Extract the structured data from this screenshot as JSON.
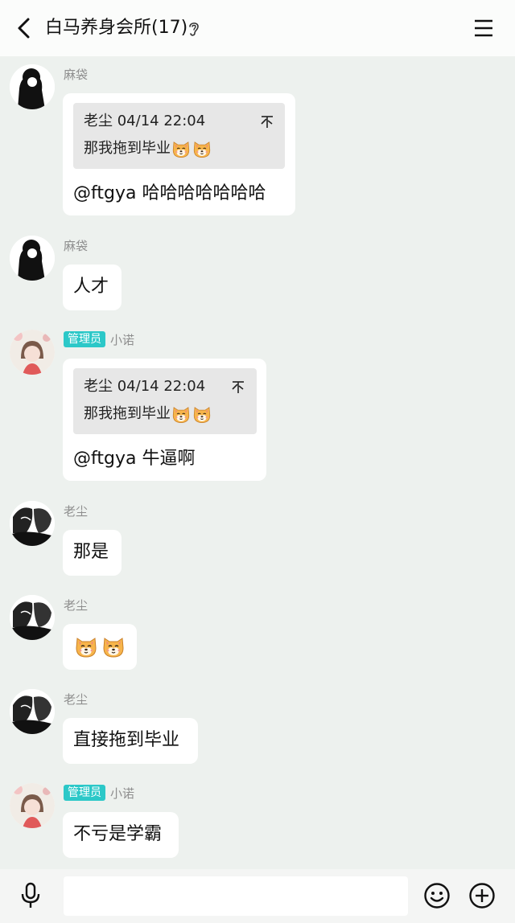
{
  "header": {
    "title": "白马养身会所(17)"
  },
  "messages": [
    {
      "sender": "麻袋",
      "quote": {
        "author_time": "老尘 04/14 22:04",
        "text": "那我拖到毕业"
      },
      "text": "@ftgya 哈哈哈哈哈哈哈"
    },
    {
      "sender": "麻袋",
      "text": "人才"
    },
    {
      "badge": "管理员",
      "sender": "小诺",
      "quote": {
        "author_time": "老尘 04/14 22:04",
        "text": "那我拖到毕业"
      },
      "text": "@ftgya 牛逼啊"
    },
    {
      "sender": "老尘",
      "text": "那是"
    },
    {
      "sender": "老尘",
      "emoji": [
        "shiba-emoji",
        "shiba-emoji"
      ]
    },
    {
      "sender": "老尘",
      "text": "直接拖到毕业"
    },
    {
      "badge": "管理员",
      "sender": "小诺",
      "text": "不亏是学霸"
    }
  ],
  "footer": {
    "input_placeholder": ""
  },
  "icons": {
    "back": "back-arrow-icon",
    "ear": "ear-icon",
    "menu": "menu-icon",
    "pin": "pin-icon",
    "mic": "microphone-icon",
    "smile": "emoji-icon",
    "plus": "plus-icon"
  },
  "colors": {
    "background": "#edf1ee",
    "badge": "#2cc8c8",
    "bubble": "#ffffff",
    "quote": "#e7e7e7"
  }
}
